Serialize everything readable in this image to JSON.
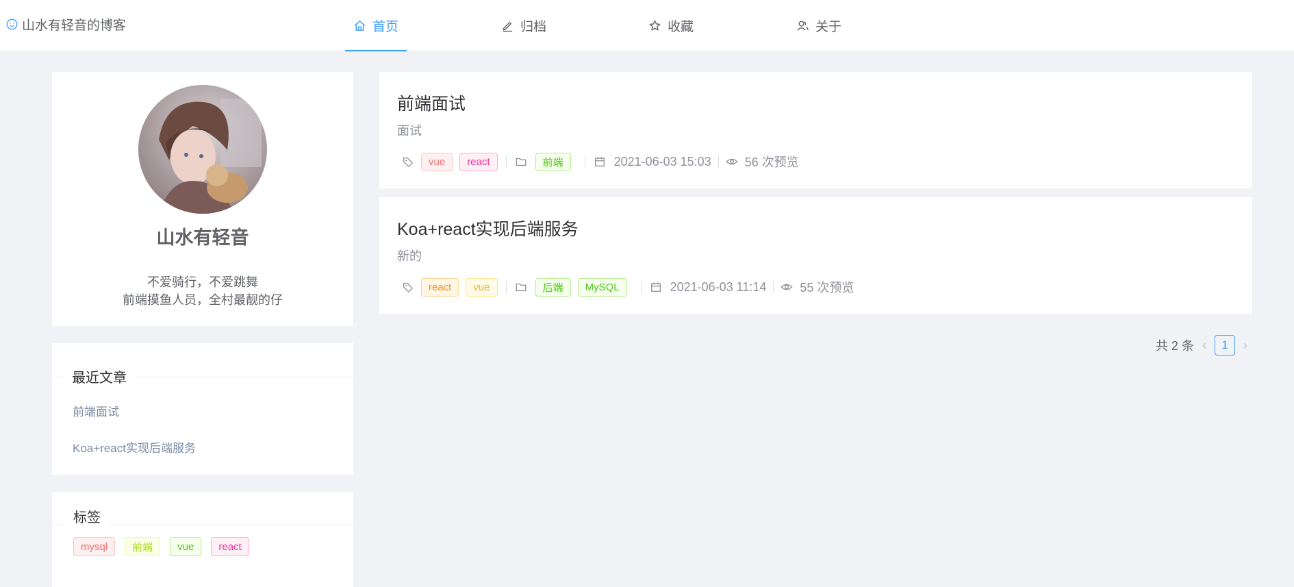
{
  "header": {
    "brand": "山水有轻音的博客",
    "nav": [
      {
        "label": "首页",
        "icon": "home-icon"
      },
      {
        "label": "归档",
        "icon": "edit-icon"
      },
      {
        "label": "收藏",
        "icon": "star-icon"
      },
      {
        "label": "关于",
        "icon": "users-icon"
      }
    ]
  },
  "profile": {
    "name": "山水有轻音",
    "bio": [
      "不爱骑行，不爱跳舞",
      "前端摸鱼人员，全村最靓的仔"
    ]
  },
  "recent": {
    "title": "最近文章",
    "items": [
      "前端面试",
      "Koa+react实现后端服务"
    ]
  },
  "tags": {
    "title": "标签",
    "items": [
      {
        "label": "mysql",
        "color": "#f56c6c"
      },
      {
        "label": "前端",
        "color": "#a0d911"
      },
      {
        "label": "vue",
        "color": "#67c23a"
      },
      {
        "label": "react",
        "color": "#eb2f96"
      }
    ]
  },
  "posts": [
    {
      "title": "前端面试",
      "desc": "面试",
      "tags": [
        {
          "label": "vue",
          "color": "#f56c6c"
        },
        {
          "label": "react",
          "color": "#eb2f96"
        }
      ],
      "categories": [
        {
          "label": "前端",
          "color": "#52c41a"
        }
      ],
      "date": "2021-06-03 15:03",
      "views": "56 次预览"
    },
    {
      "title": "Koa+react实现后端服务",
      "desc": "新的",
      "tags": [
        {
          "label": "react",
          "color": "#fa8c16"
        },
        {
          "label": "vue",
          "color": "#faad14"
        }
      ],
      "categories": [
        {
          "label": "后端",
          "color": "#52c41a"
        },
        {
          "label": "MySQL",
          "color": "#52c41a"
        }
      ],
      "date": "2021-06-03 11:14",
      "views": "55 次预览"
    }
  ],
  "pagination": {
    "total": "共 2 条",
    "current": "1"
  },
  "colors": {
    "accent": "#409eff",
    "background": "#f0f2f5"
  }
}
